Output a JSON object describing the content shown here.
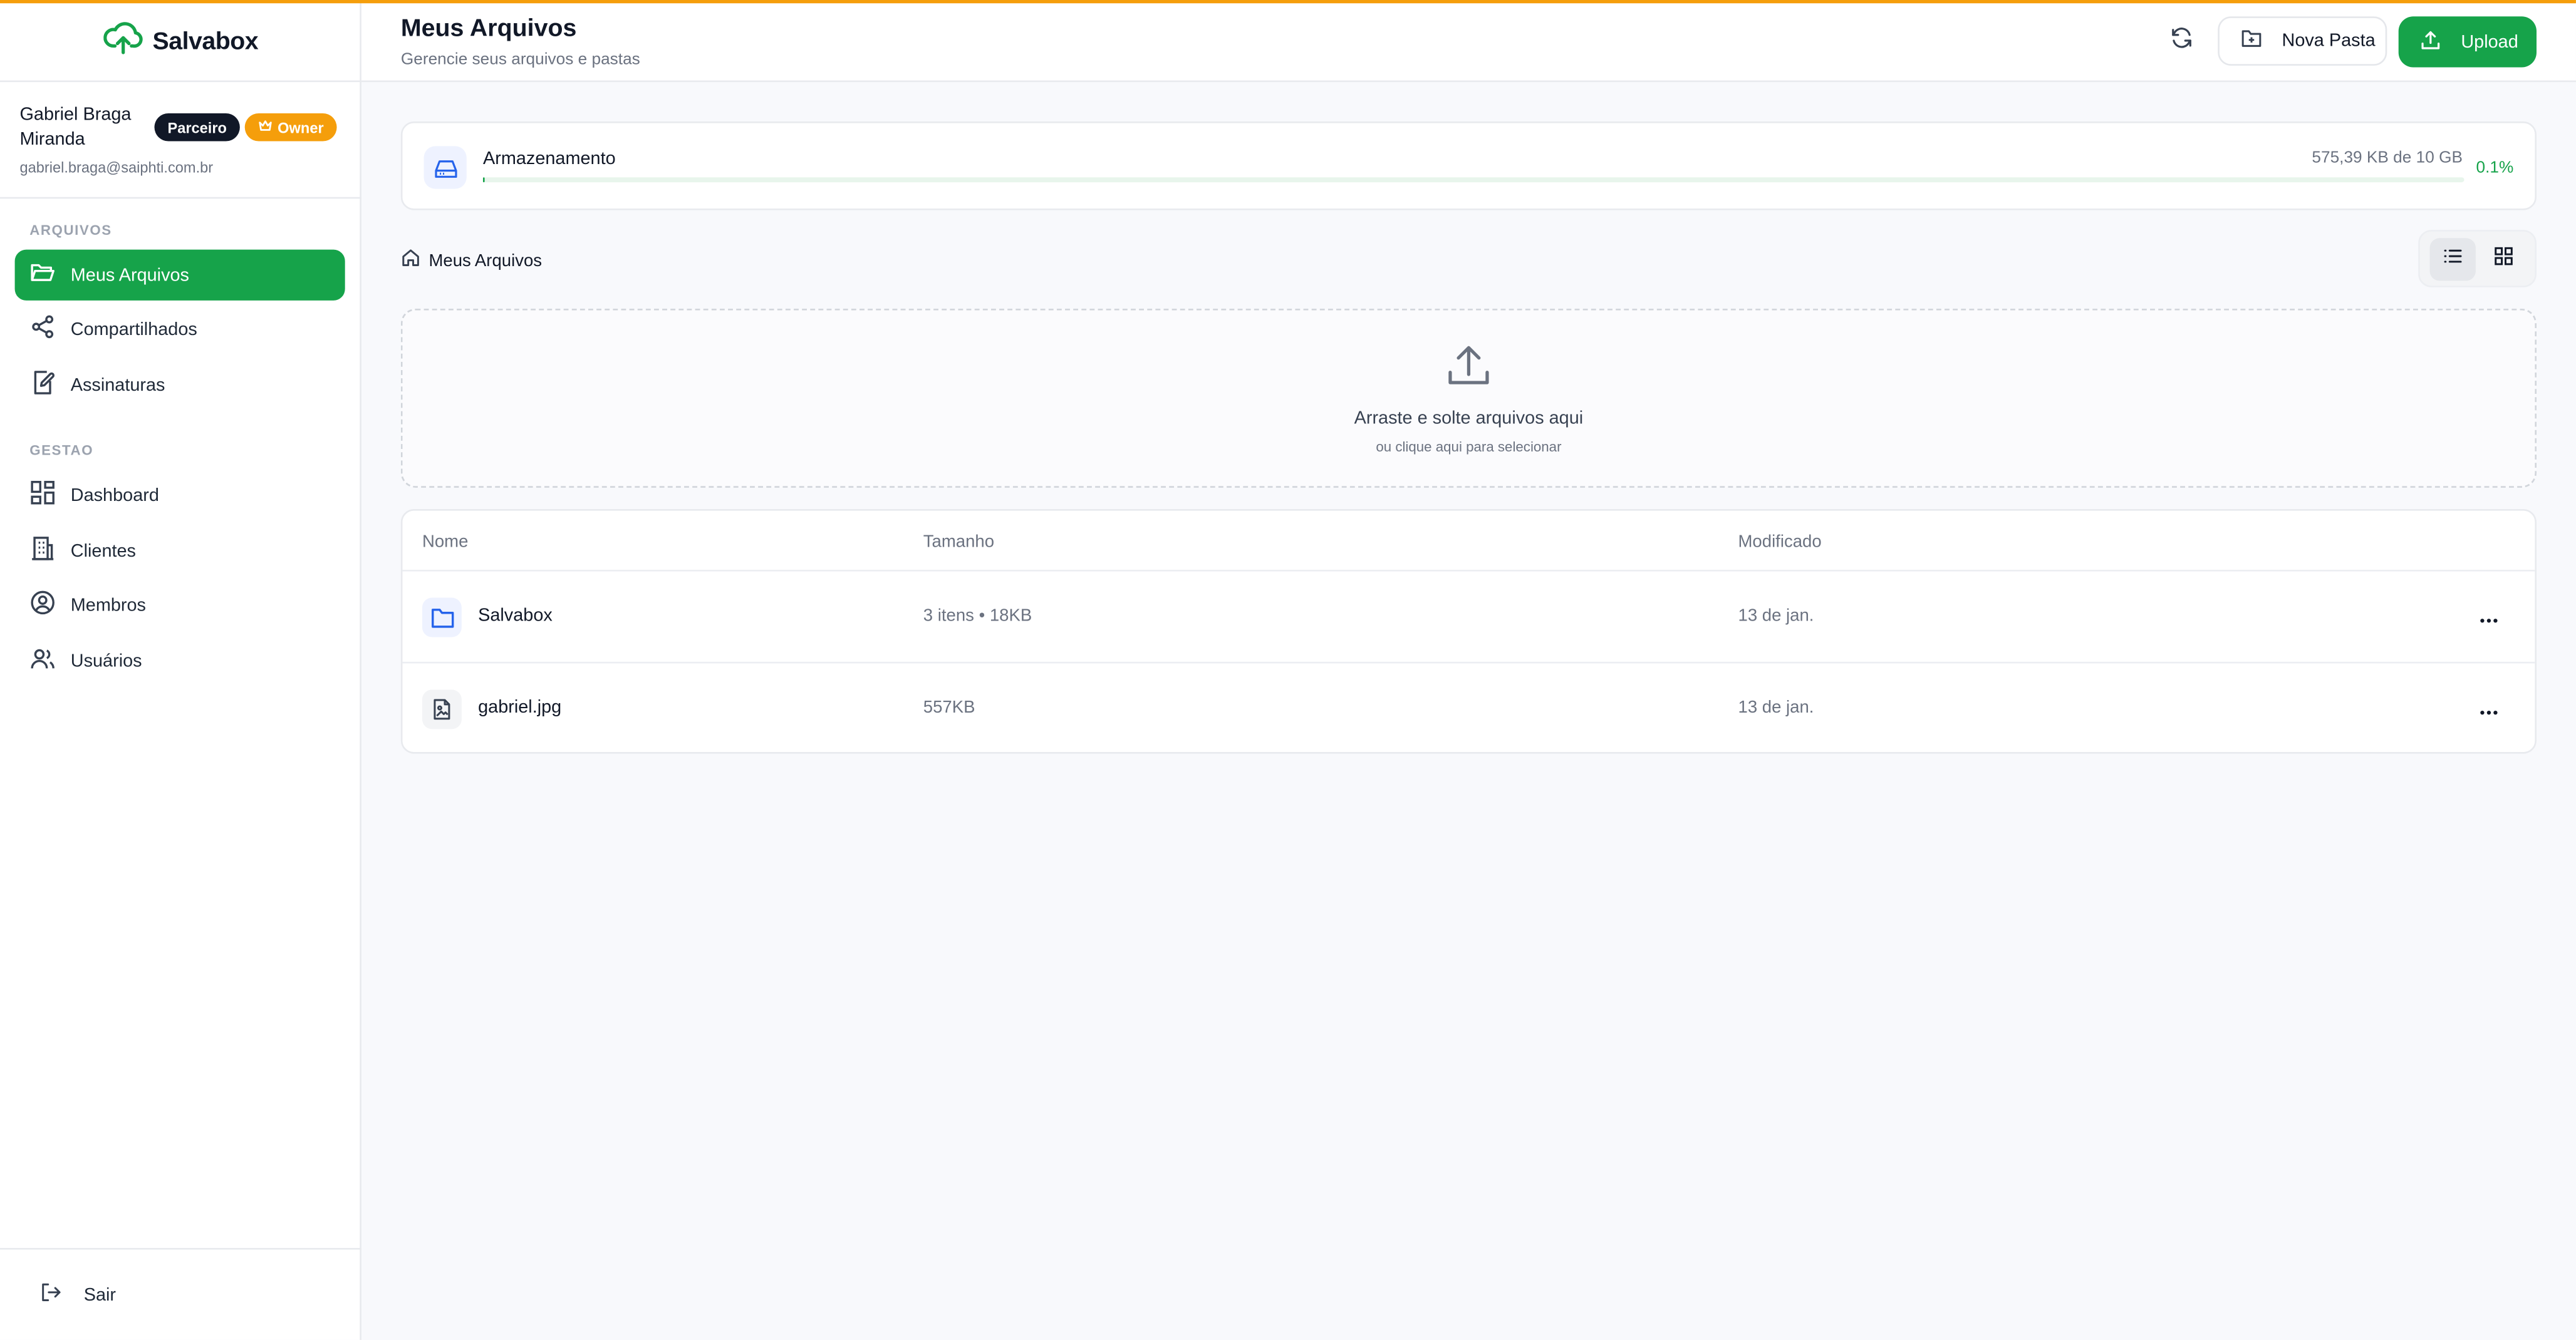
{
  "brand": {
    "name": "Salvabox",
    "accent": "#16a34a",
    "top_accent": "#f59e0b"
  },
  "user": {
    "name": "Gabriel Braga Miranda",
    "email": "gabriel.braga@saiphti.com.br",
    "badges": {
      "partner": "Parceiro",
      "owner": "Owner"
    }
  },
  "sidebar": {
    "sections": {
      "files": "ARQUIVOS",
      "management": "GESTAO"
    },
    "items": [
      {
        "label": "Meus Arquivos",
        "icon": "folder-open-icon",
        "active": true
      },
      {
        "label": "Compartilhados",
        "icon": "share-icon"
      },
      {
        "label": "Assinaturas",
        "icon": "signature-icon"
      },
      {
        "label": "Dashboard",
        "icon": "dashboard-icon"
      },
      {
        "label": "Clientes",
        "icon": "building-icon"
      },
      {
        "label": "Membros",
        "icon": "user-circle-icon"
      },
      {
        "label": "Usuários",
        "icon": "users-icon"
      }
    ],
    "logout": "Sair"
  },
  "header": {
    "title": "Meus Arquivos",
    "subtitle": "Gerencie seus arquivos e pastas",
    "new_folder": "Nova Pasta",
    "upload": "Upload"
  },
  "storage": {
    "label": "Armazenamento",
    "used": "575,39 KB de 10 GB",
    "percent_text": "0.1%",
    "percent": 0.1
  },
  "breadcrumb": {
    "root": "Meus Arquivos"
  },
  "dropzone": {
    "title": "Arraste e solte arquivos aqui",
    "subtitle": "ou clique aqui para selecionar"
  },
  "table": {
    "columns": {
      "name": "Nome",
      "size": "Tamanho",
      "modified": "Modificado"
    },
    "rows": [
      {
        "name": "Salvabox",
        "size": "3 itens • 18KB",
        "modified": "13 de jan.",
        "type": "folder"
      },
      {
        "name": "gabriel.jpg",
        "size": "557KB",
        "modified": "13 de jan.",
        "type": "image-file"
      }
    ]
  }
}
